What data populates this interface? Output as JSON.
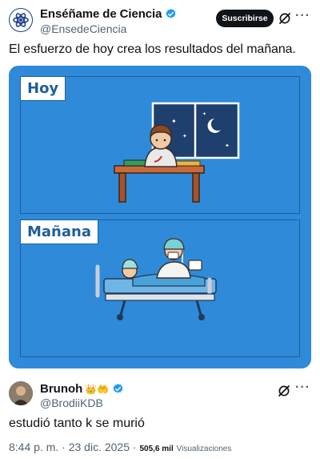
{
  "post": {
    "author_name": "Enséñame de Ciencia",
    "author_handle": "@EnsedeCiencia",
    "subscribe_label": "Suscribirse",
    "more_label": "···",
    "text": "El esfuerzo de hoy crea los resultados del mañana.",
    "verified_color": "#1d9bf0"
  },
  "media": {
    "background_color": "#2f8ad9",
    "panels": [
      {
        "label": "Hoy"
      },
      {
        "label": "Mañana"
      }
    ]
  },
  "reply": {
    "author_name": "Brunoh",
    "author_emojis": "👑🤲",
    "author_handle": "@BrodiiKDB",
    "more_label": "···",
    "text": "estudió tanto k se murió"
  },
  "meta": {
    "time": "8:44 p. m.",
    "separator": "·",
    "date": "23 dic. 2025",
    "separator2": "·",
    "views_count": "505,6 mil",
    "views_label": "Visualizaciones"
  }
}
